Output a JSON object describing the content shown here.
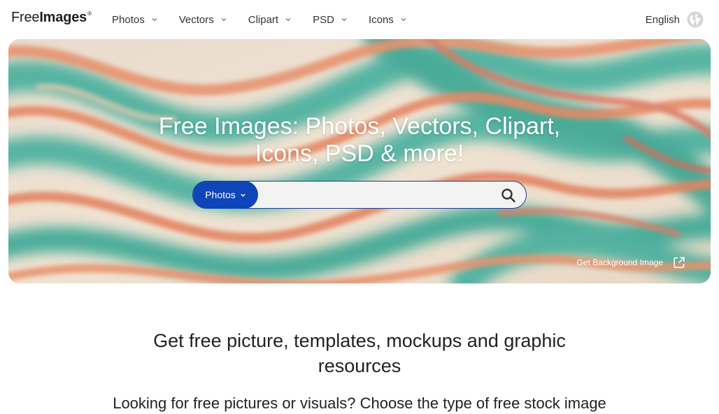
{
  "header": {
    "logo": {
      "part1": "Free",
      "part2": "Images",
      "mark": "®"
    },
    "nav": [
      {
        "label": "Photos",
        "icon": "chevron-down-icon"
      },
      {
        "label": "Vectors",
        "icon": "chevron-down-icon"
      },
      {
        "label": "Clipart",
        "icon": "chevron-down-icon"
      },
      {
        "label": "PSD",
        "icon": "chevron-down-icon"
      },
      {
        "label": "Icons",
        "icon": "chevron-down-icon"
      }
    ],
    "language": {
      "label": "English",
      "icon": "globe-icon"
    }
  },
  "hero": {
    "title_line1": "Free Images: Photos, Vectors, Clipart,",
    "title_line2": "Icons, PSD & more!",
    "search": {
      "type_label": "Photos",
      "placeholder": "",
      "value": "",
      "button_icon": "search-icon"
    },
    "background_link": {
      "label": "Get Background Image",
      "icon": "external-link-icon"
    },
    "colors": {
      "search_type_bg": "#0e45b8",
      "teal": "#1e9e8a",
      "orange": "#e07a55",
      "cream": "#efe3d2"
    }
  },
  "main": {
    "subheading_line1": "Get free picture, templates, mockups and graphic",
    "subheading_line2": "resources",
    "intro": "Looking for free pictures or visuals? Choose the type of free stock image"
  }
}
